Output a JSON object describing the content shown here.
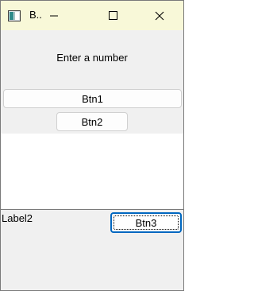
{
  "window": {
    "title": "B..",
    "icons": {
      "app": "app-window-icon",
      "minimize": "minimize-icon",
      "maximize": "maximize-icon",
      "close": "close-icon"
    }
  },
  "main": {
    "prompt": "Enter a number",
    "btn1_label": "Btn1",
    "btn2_label": "Btn2",
    "text_area_value": "",
    "label2": "Label2",
    "btn3_label": "Btn3"
  },
  "colors": {
    "titlebar": "#f8f8d8",
    "window_bg": "#f0f0f0",
    "focus_border": "#0067c0"
  }
}
